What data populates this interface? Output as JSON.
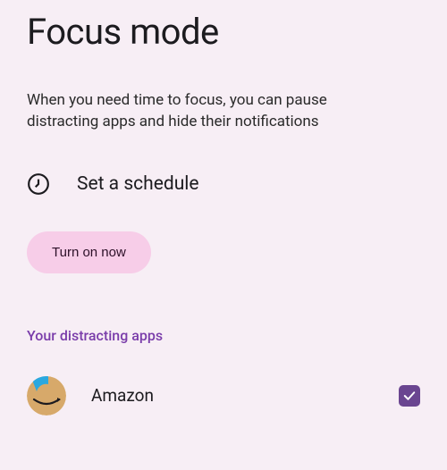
{
  "page": {
    "title": "Focus mode",
    "description": "When you need time to focus, you can pause distracting apps and hide their notifications"
  },
  "schedule": {
    "label": "Set a schedule",
    "icon": "clock-icon"
  },
  "actions": {
    "turn_on_label": "Turn on now"
  },
  "apps_section": {
    "header": "Your distracting apps",
    "items": [
      {
        "name": "Amazon",
        "icon": "amazon-icon",
        "checked": true
      }
    ]
  },
  "colors": {
    "accent": "#7a3daa",
    "button_bg": "#f7cde8",
    "checkbox_bg": "#6a4590",
    "page_bg": "#f7eef5"
  }
}
